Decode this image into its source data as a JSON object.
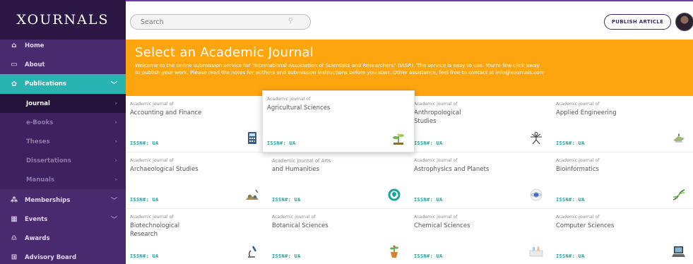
{
  "app": {
    "logo": "XOURNALS"
  },
  "sidebar": {
    "items": [
      {
        "label": "Home",
        "icon": "home-icon",
        "glyph": "⌂"
      },
      {
        "label": "About",
        "icon": "book-icon",
        "glyph": "▭"
      },
      {
        "label": "Publications",
        "icon": "publications-icon",
        "glyph": "✿"
      }
    ],
    "sub_items": [
      {
        "label": "Journal"
      },
      {
        "label": "e-Books"
      },
      {
        "label": "Theses"
      },
      {
        "label": "Dissertations"
      },
      {
        "label": "Manuals"
      }
    ],
    "lower_items": [
      {
        "label": "Memberships",
        "icon": "members-icon",
        "glyph": "⁂"
      },
      {
        "label": "Events",
        "icon": "calendar-icon",
        "glyph": "▦"
      },
      {
        "label": "Awards",
        "icon": "award-icon",
        "glyph": "♎"
      },
      {
        "label": "Advisory Board",
        "icon": "board-icon",
        "glyph": "⊞"
      }
    ]
  },
  "search": {
    "placeholder": "Search"
  },
  "topbar": {
    "publish_label": "PUBLISH ARTICLE"
  },
  "banner": {
    "title": "Select an Academic Journal",
    "text": "Welcome to the online submission service for \"International Association of Scientists and Researchers\" (IASR). The service is easy to use. You're few click away to publish your work. Please read the notes for authors and submission instructions before you start. Other assistance, feel free to contact at info@xournals.com"
  },
  "cards": [
    {
      "pre": "Academic journal of",
      "title": "Accounting and Finance",
      "issn": "ISSN#: UA",
      "icon": "calculator-icon"
    },
    {
      "pre": "Academic journal of",
      "title": "Agricultural Sciences",
      "issn": "ISSN#: UA",
      "icon": "plant-icon"
    },
    {
      "pre": "Academic journal of",
      "title": "Anthropological Studies",
      "issn": "ISSN#: UA",
      "icon": "human-figure-icon"
    },
    {
      "pre": "Academic journal of",
      "title": "Applied Engineering",
      "issn": "ISSN#: UA",
      "icon": "engineering-icon"
    },
    {
      "pre": "Academic journal of",
      "title": "Archaeological Studies",
      "issn": "ISSN#: UA",
      "icon": "archaeology-icon"
    },
    {
      "pre": "Academic journal of Arts",
      "title": "and Humanities",
      "issn": "ISSN#: UA",
      "icon": "arts-icon"
    },
    {
      "pre": "Academic journal of",
      "title": "Astrophysics and Planets",
      "issn": "ISSN#: UA",
      "icon": "planet-icon"
    },
    {
      "pre": "Academic journal of",
      "title": "Bioinformatics",
      "issn": "ISSN#: UA",
      "icon": "dna-icon"
    },
    {
      "pre": "Academic journal of",
      "title": "Biotechnological Research",
      "issn": "ISSN#: UA",
      "icon": "microscope-icon"
    },
    {
      "pre": "Academic journal of",
      "title": "Botanical Sciences",
      "issn": "ISSN#: UA",
      "icon": "potted-plant-icon"
    },
    {
      "pre": "Academic journal of",
      "title": "Chemical Sciences",
      "issn": "ISSN#: UA",
      "icon": "chemistry-icon"
    },
    {
      "pre": "Academic journal of",
      "title": "Computer Sciences",
      "issn": "ISSN#: UA",
      "icon": "computer-icon"
    }
  ],
  "colors": {
    "sidebar": "#4a2a6e",
    "active": "#28b4b0",
    "banner": "#fda50f",
    "issn": "#2a9d9a"
  }
}
